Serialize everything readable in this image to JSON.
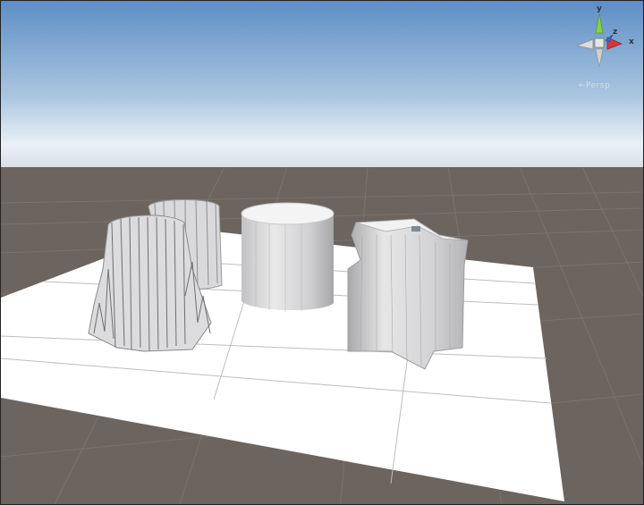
{
  "scene_view": {
    "gizmo": {
      "axis_y": "y",
      "axis_z": "z",
      "axis_x": "x",
      "projection_label": "←Persp"
    }
  },
  "colors": {
    "sky_top": "#5f8fc5",
    "sky_horizon": "#eef4fa",
    "ground": "#6b645f",
    "plane": "#ffffff",
    "mesh": "#d8d8d8",
    "gizmo_y": "#8ad14a",
    "gizmo_x": "#d6363a",
    "gizmo_z": "#3a6fd1"
  },
  "icons": {
    "orientation_gizmo": "axis-gizmo-icon"
  }
}
